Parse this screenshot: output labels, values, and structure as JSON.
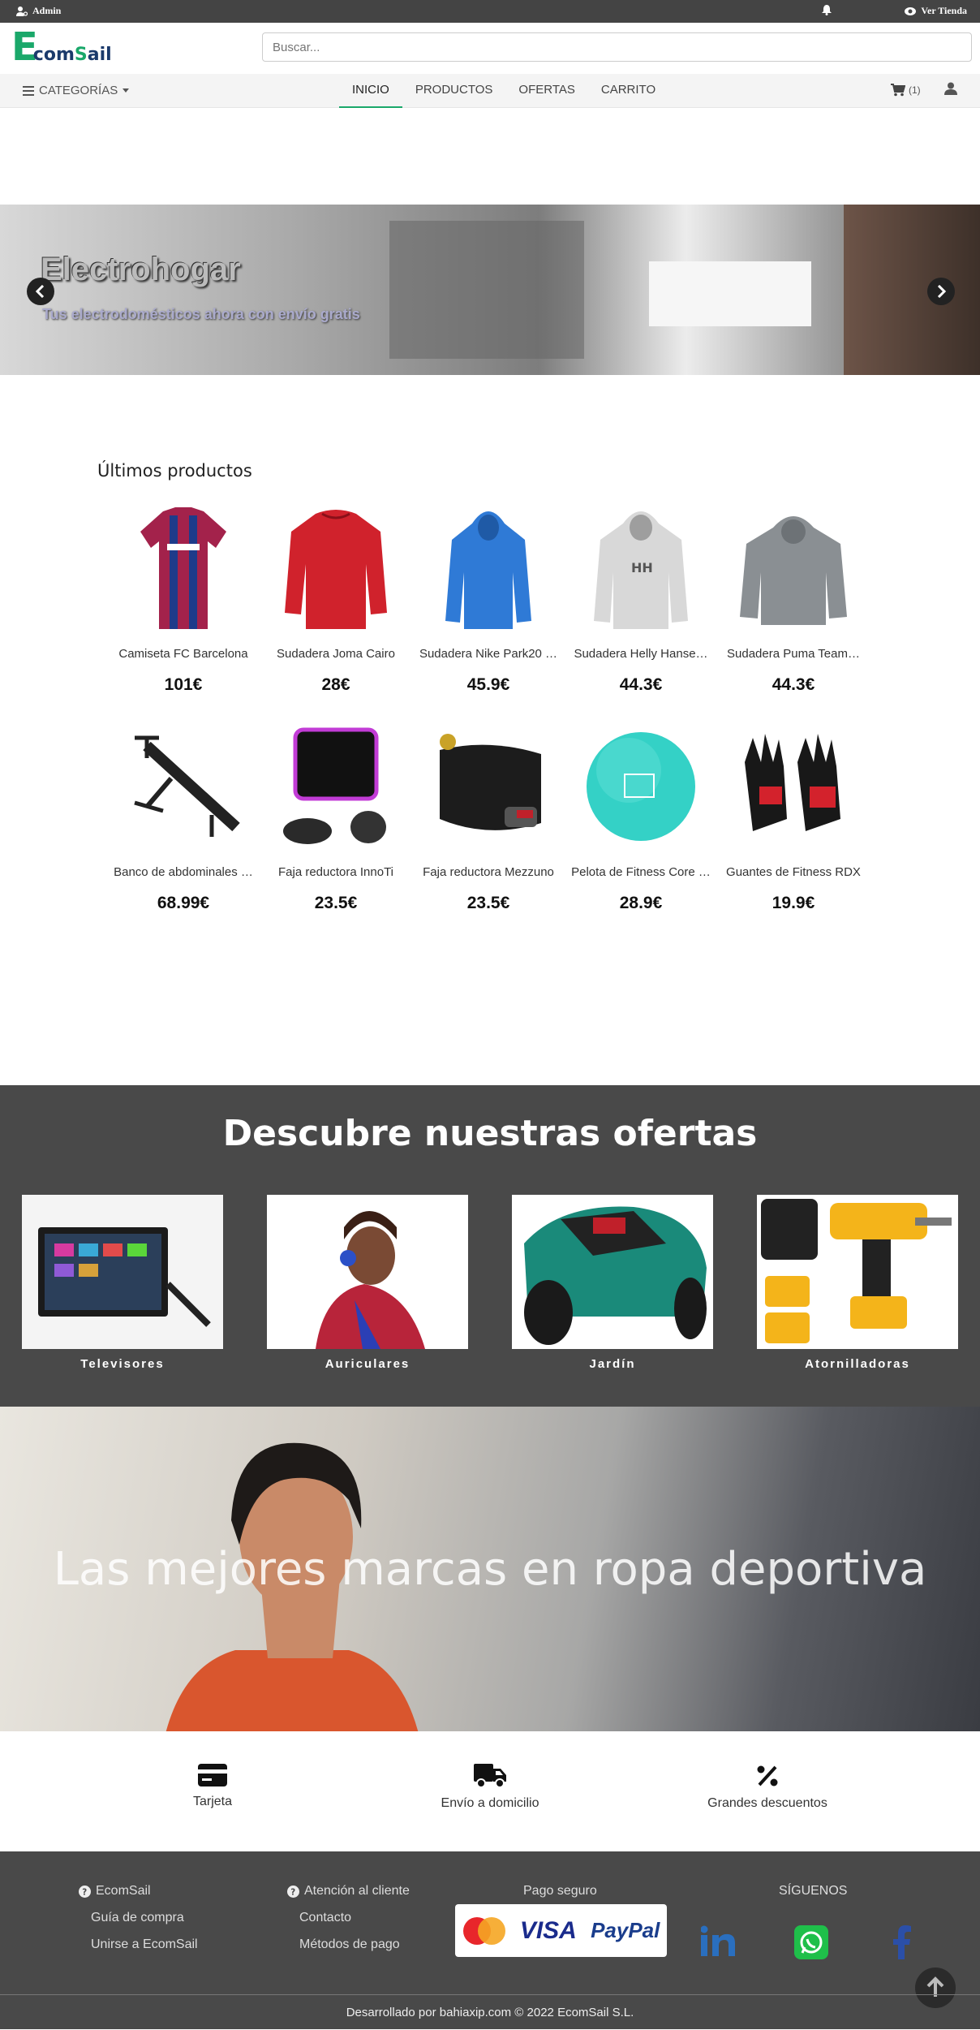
{
  "topbar": {
    "admin": "Admin",
    "view_store": "Ver Tienda"
  },
  "header": {
    "logo_initial": "E",
    "logo_rest_a": "com",
    "logo_rest_b": "S",
    "logo_rest_c": "ail",
    "search_placeholder": "Buscar..."
  },
  "nav": {
    "categories": "CATEGORÍAS",
    "items": [
      "INICIO",
      "PRODUCTOS",
      "OFERTAS",
      "CARRITO"
    ],
    "active": "INICIO",
    "cart_count": "(1)"
  },
  "banner": {
    "title": "Electrohogar",
    "subtitle": "Tus electrodomésticos ahora con envío gratis"
  },
  "latest": {
    "title": "Últimos productos",
    "products": [
      {
        "name": "Camiseta FC Barcelona",
        "price": "101€"
      },
      {
        "name": "Sudadera Joma Cairo",
        "price": "28€"
      },
      {
        "name": "Sudadera Nike Park20 …",
        "price": "45.9€"
      },
      {
        "name": "Sudadera Helly Hanse…",
        "price": "44.3€"
      },
      {
        "name": "Sudadera Puma Team…",
        "price": "44.3€"
      },
      {
        "name": "Banco de abdominales …",
        "price": "68.99€"
      },
      {
        "name": "Faja reductora InnoTi",
        "price": "23.5€"
      },
      {
        "name": "Faja reductora Mezzuno",
        "price": "23.5€"
      },
      {
        "name": "Pelota de Fitness Core …",
        "price": "28.9€"
      },
      {
        "name": "Guantes de Fitness RDX",
        "price": "19.9€"
      }
    ]
  },
  "offers": {
    "title": "Descubre nuestras ofertas",
    "items": [
      "Televisores",
      "Auriculares",
      "Jardín",
      "Atornilladoras"
    ]
  },
  "hero": {
    "text": "Las mejores marcas en ropa deportiva"
  },
  "features": [
    "Tarjeta",
    "Envío a domicilio",
    "Grandes descuentos"
  ],
  "footer": {
    "col1": {
      "title": "EcomSail",
      "links": [
        "Guía de compra",
        "Unirse a EcomSail"
      ]
    },
    "col2": {
      "title": "Atención al cliente",
      "links": [
        "Contacto",
        "Métodos de pago"
      ]
    },
    "payment_title": "Pago seguro",
    "payments": [
      "MasterCard",
      "VISA",
      "PayPal"
    ],
    "social_title": "SÍGUENOS",
    "copyright": "Desarrollado por bahiaxip.com © 2022 EcomSail S.L."
  },
  "colors": {
    "brand_green": "#1aa86a",
    "brand_navy": "#1b3a6b",
    "dark_bg": "#494949",
    "topbar_bg": "#444444"
  }
}
